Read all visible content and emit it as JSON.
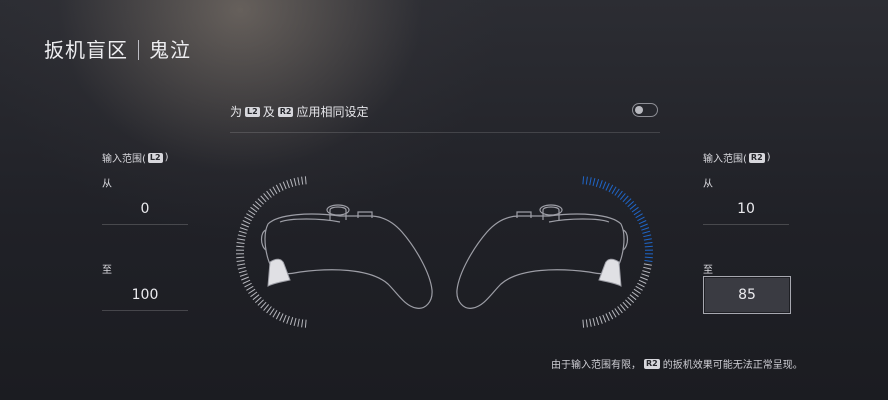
{
  "header": {
    "section": "扳机盲区",
    "subsection": "鬼泣"
  },
  "toggle": {
    "prefix": "为",
    "l2_badge": "L2",
    "connector": "及",
    "r2_badge": "R2",
    "suffix": "应用相同设定",
    "state": "off"
  },
  "left_panel": {
    "header_text": "输入范围(",
    "badge": "L2",
    "header_close": ")",
    "from_label": "从",
    "from_value": "0",
    "to_label": "至",
    "to_value": "100"
  },
  "right_panel": {
    "header_text": "输入范围(",
    "badge": "R2",
    "header_close": ")",
    "from_label": "从",
    "from_value": "10",
    "to_label": "至",
    "to_value": "85"
  },
  "note": {
    "prefix": "由于输入范围有限，",
    "badge": "R2",
    "suffix": "的扳机效果可能无法正常呈现。"
  },
  "colors": {
    "accent": "#1f66c9",
    "background": "#202127"
  }
}
